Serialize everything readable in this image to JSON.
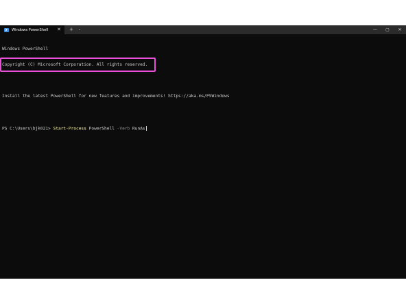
{
  "window": {
    "tab_title": "Windows PowerShell",
    "tab_close": "✕",
    "new_tab": "+",
    "dropdown": "⌄",
    "minimize": "—",
    "maximize": "▢",
    "close": "✕"
  },
  "terminal": {
    "lines": [
      "Windows PowerShell",
      "Copyright (C) Microsoft Corporation. All rights reserved.",
      "",
      "Install the latest PowerShell for new features and improvements! https://aka.ms/PSWindows",
      ""
    ],
    "prompt": "PS C:\\Users\\bjk021> ",
    "command": {
      "cmdlet": "Start-Process",
      "arg1": " PowerShell ",
      "param": "-Verb",
      "value": " RunAs"
    }
  },
  "colors": {
    "terminal_bg": "#0c0c0c",
    "titlebar_bg": "#2b2b2b",
    "highlight": "#e94fd7",
    "cmdlet": "#f9f1a5",
    "param": "#8a8a8a"
  }
}
